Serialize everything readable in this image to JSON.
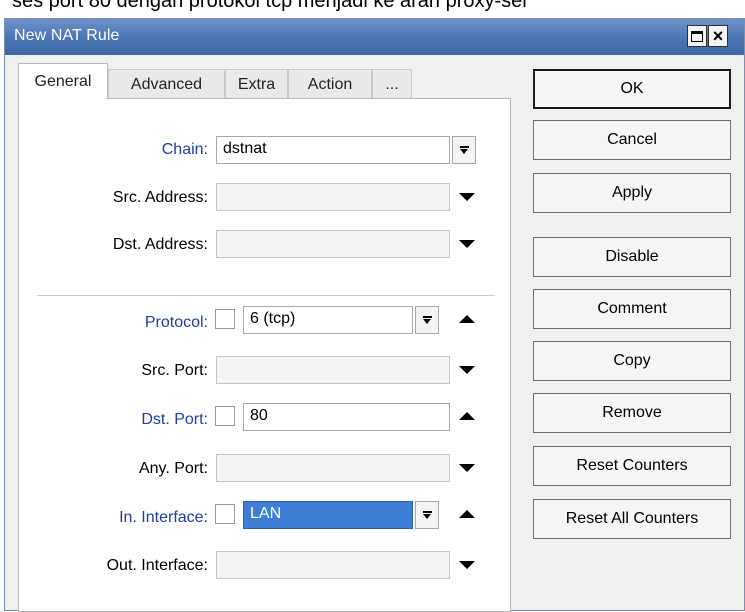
{
  "page_caption": "ses port 80 dengan protokol tcp menjadi ke arah proxy-ser",
  "window": {
    "title": "New NAT Rule"
  },
  "tabs": [
    {
      "label": "General",
      "active": true
    },
    {
      "label": "Advanced",
      "active": false
    },
    {
      "label": "Extra",
      "active": false
    },
    {
      "label": "Action",
      "active": false
    },
    {
      "label": "...",
      "active": false
    }
  ],
  "form": {
    "chain": {
      "label": "Chain:",
      "value": "dstnat"
    },
    "src_address": {
      "label": "Src. Address:",
      "value": ""
    },
    "dst_address": {
      "label": "Dst. Address:",
      "value": ""
    },
    "protocol": {
      "label": "Protocol:",
      "value": "6 (tcp)"
    },
    "src_port": {
      "label": "Src. Port:",
      "value": ""
    },
    "dst_port": {
      "label": "Dst. Port:",
      "value": "80"
    },
    "any_port": {
      "label": "Any. Port:",
      "value": ""
    },
    "in_interface": {
      "label": "In. Interface:",
      "value": "LAN"
    },
    "out_interface": {
      "label": "Out. Interface:",
      "value": ""
    }
  },
  "buttons": {
    "ok": "OK",
    "cancel": "Cancel",
    "apply": "Apply",
    "disable": "Disable",
    "comment": "Comment",
    "copy": "Copy",
    "remove": "Remove",
    "reset_counters": "Reset Counters",
    "reset_all_counters": "Reset All Counters"
  },
  "colors": {
    "titlebar": "#4a74b3",
    "label_blue": "#1d3fa8",
    "selection": "#3d7fd6"
  }
}
